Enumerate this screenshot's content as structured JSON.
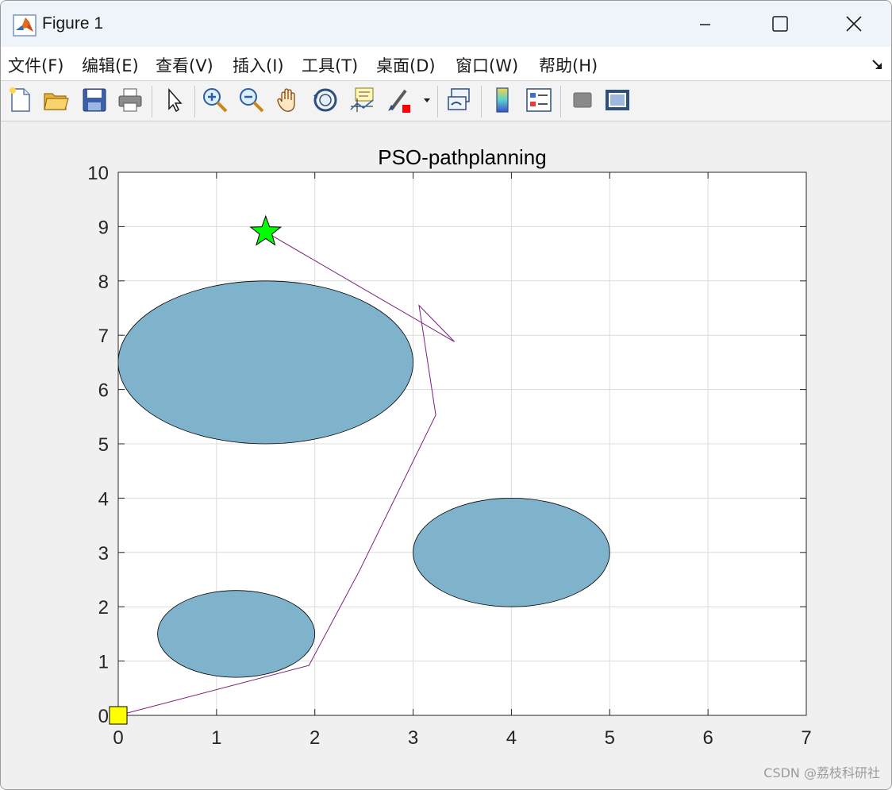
{
  "window": {
    "title": "Figure 1"
  },
  "menu": {
    "items": [
      "文件(F)",
      "编辑(E)",
      "查看(V)",
      "插入(I)",
      "工具(T)",
      "桌面(D)",
      "窗口(W)",
      "帮助(H)"
    ]
  },
  "toolbar": {
    "icons": [
      "new-figure-icon",
      "open-file-icon",
      "save-icon",
      "print-icon",
      "pointer-icon",
      "zoom-in-icon",
      "zoom-out-icon",
      "pan-hand-icon",
      "rotate-3d-icon",
      "data-cursor-icon",
      "brush-icon",
      "brush-dropdown-icon",
      "link-plot-icon",
      "colorbar-icon",
      "legend-icon",
      "hide-plot-tools-icon",
      "show-plot-tools-icon"
    ]
  },
  "colors": {
    "obstacle_fill": "#7fb2cb",
    "path": "#7b1f7b",
    "start_marker": "#ffff00",
    "goal_marker": "#00ff00"
  },
  "chart_data": {
    "type": "line",
    "title": "PSO-pathplanning",
    "xlabel": "",
    "ylabel": "",
    "xlim": [
      0,
      7
    ],
    "ylim": [
      0,
      10
    ],
    "xticks": [
      0,
      1,
      2,
      3,
      4,
      5,
      6,
      7
    ],
    "yticks": [
      0,
      1,
      2,
      3,
      4,
      5,
      6,
      7,
      8,
      9,
      10
    ],
    "grid": true,
    "obstacles": [
      {
        "shape": "ellipse",
        "cx": 1.5,
        "cy": 6.5,
        "rx": 1.5,
        "ry": 1.5
      },
      {
        "shape": "ellipse",
        "cx": 4.0,
        "cy": 3.0,
        "rx": 1.0,
        "ry": 1.0
      },
      {
        "shape": "ellipse",
        "cx": 1.2,
        "cy": 1.5,
        "rx": 0.8,
        "ry": 0.8
      }
    ],
    "path": {
      "x": [
        0,
        1.94,
        2.45,
        3.23,
        3.06,
        3.42,
        1.5
      ],
      "y": [
        0,
        0.92,
        2.65,
        5.53,
        7.55,
        6.88,
        8.9
      ]
    },
    "start": {
      "x": 0,
      "y": 0,
      "marker": "square"
    },
    "goal": {
      "x": 1.5,
      "y": 8.9,
      "marker": "star"
    }
  },
  "watermark": "CSDN @荔枝科研社"
}
